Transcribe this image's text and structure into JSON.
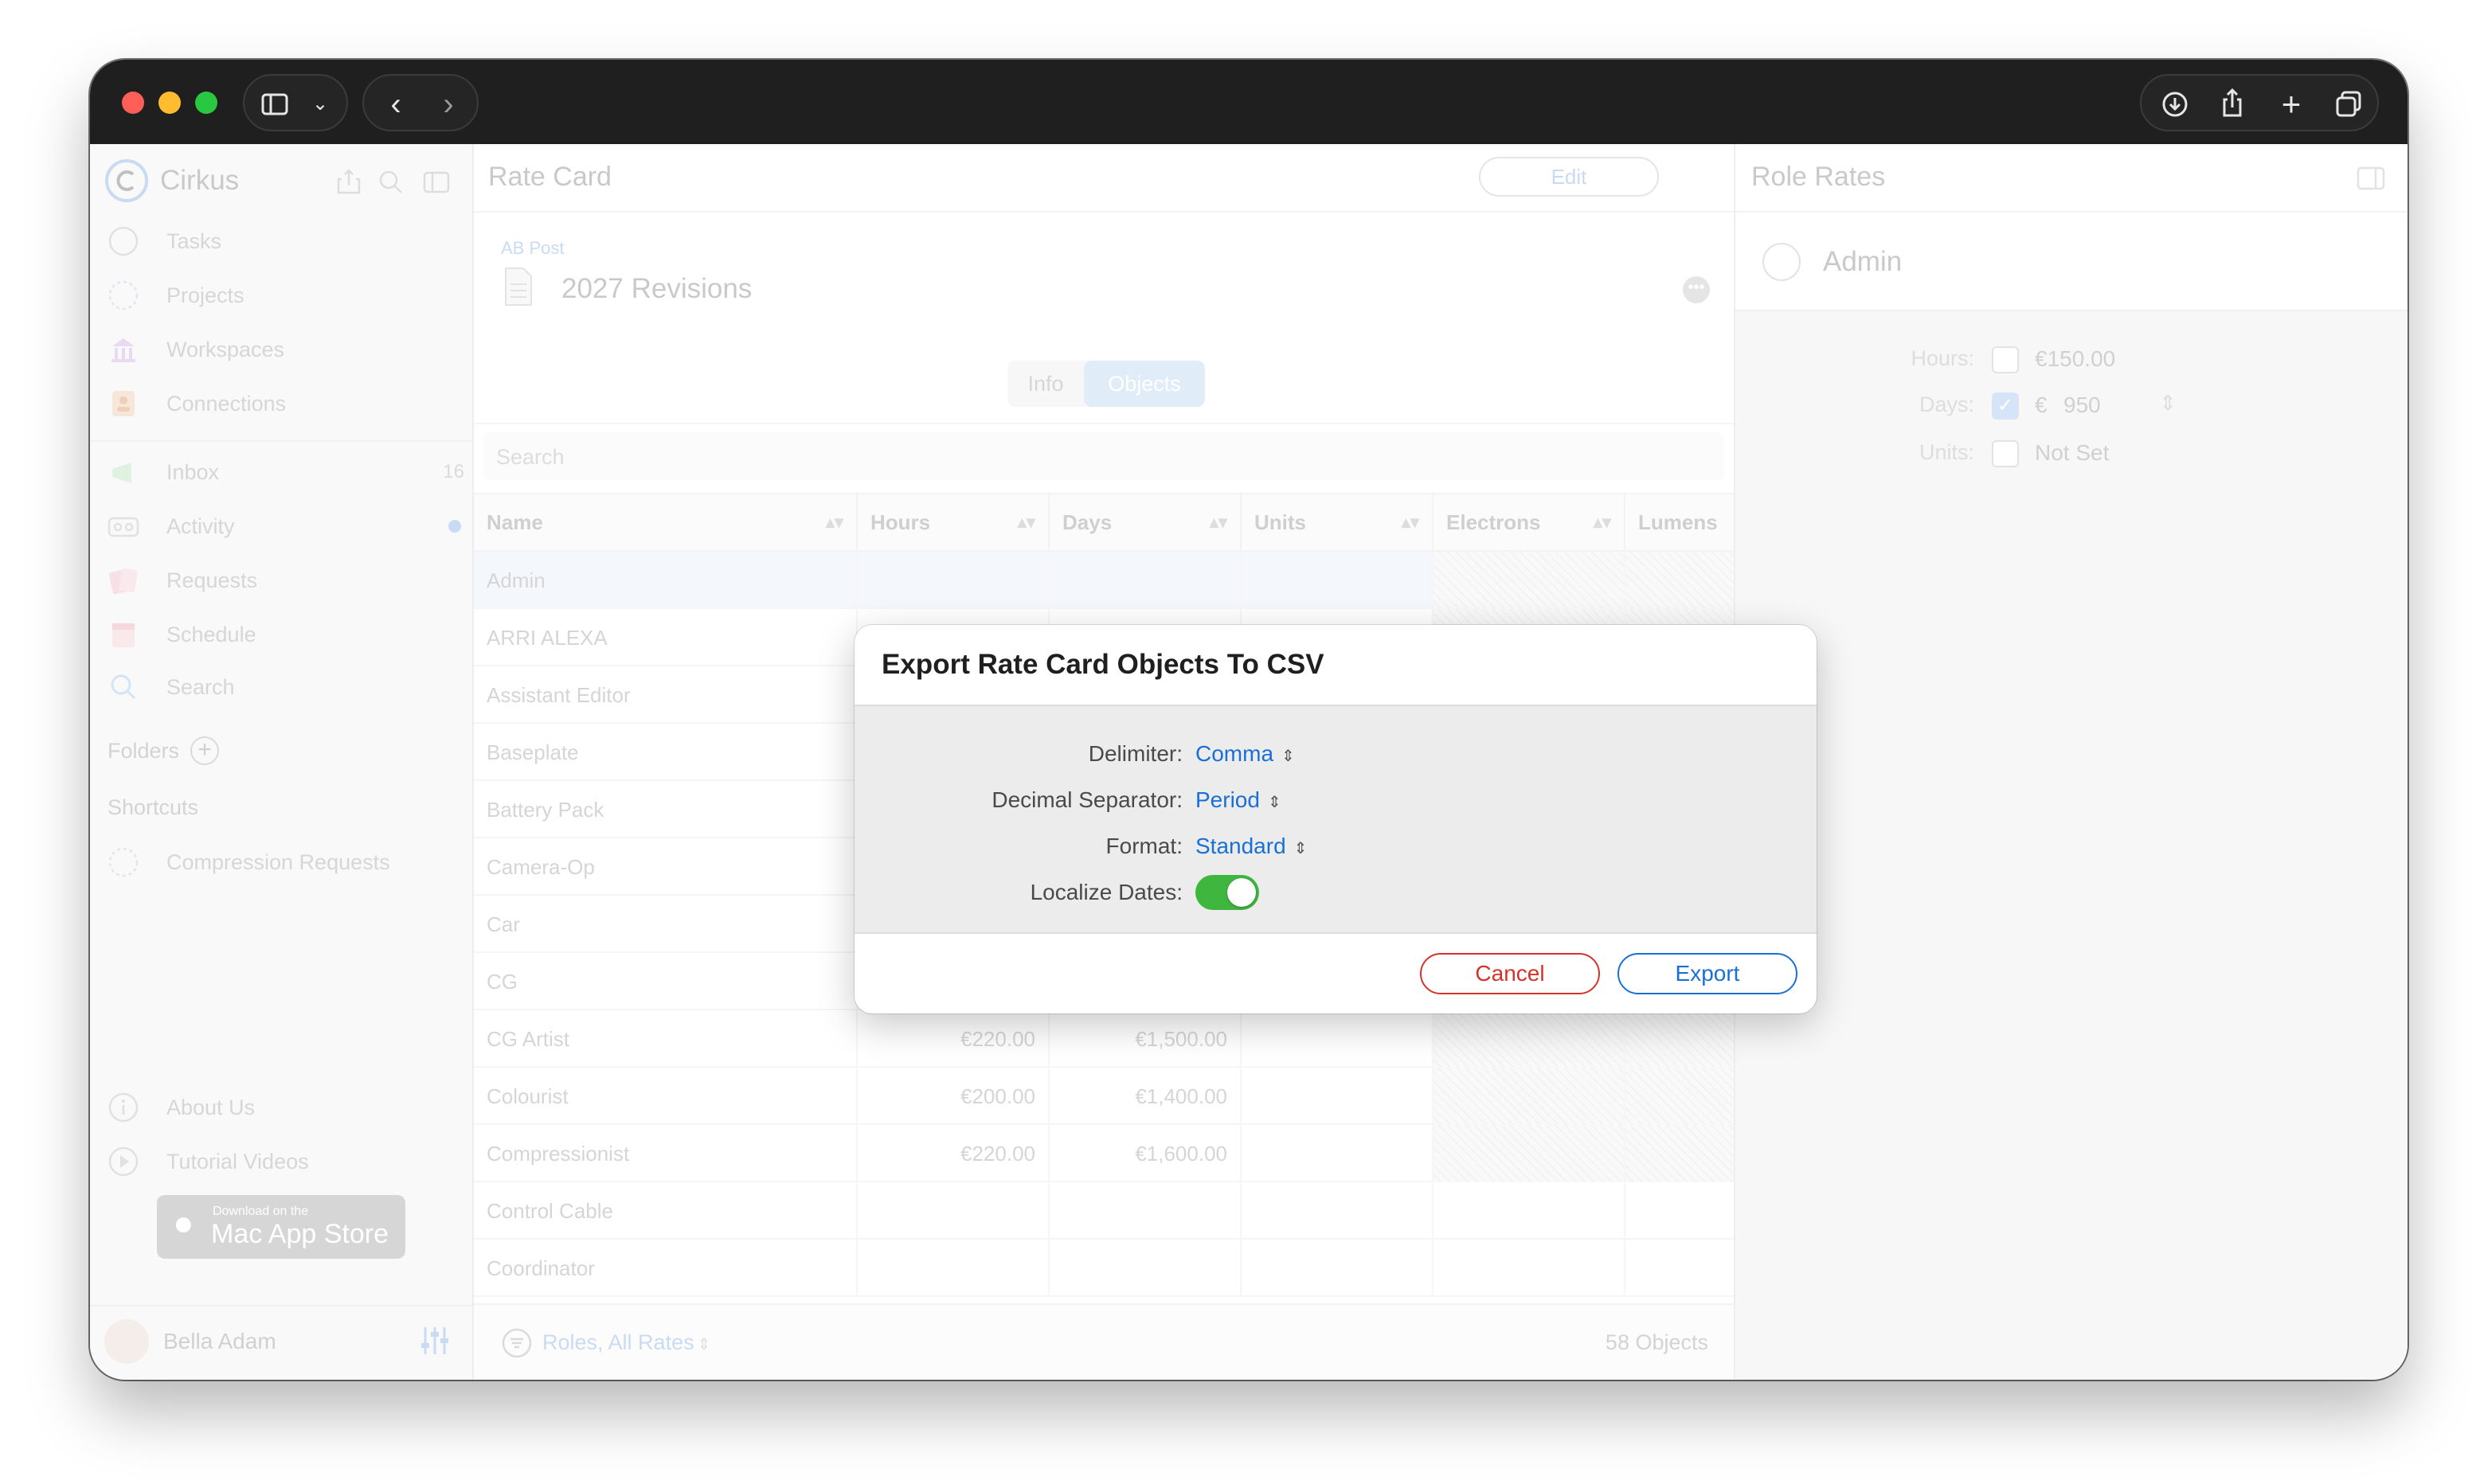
{
  "app": {
    "name": "Cirkus"
  },
  "sidebar": {
    "nav": [
      {
        "label": "Tasks",
        "icon": "circle-icon"
      },
      {
        "label": "Projects",
        "icon": "dashed-circle-icon"
      },
      {
        "label": "Workspaces",
        "icon": "carousel-icon"
      },
      {
        "label": "Connections",
        "icon": "contact-card-icon"
      }
    ],
    "nav2": [
      {
        "label": "Inbox",
        "icon": "megaphone-icon",
        "badge": "16"
      },
      {
        "label": "Activity",
        "icon": "voicemail-icon"
      },
      {
        "label": "Requests",
        "icon": "cards-icon"
      },
      {
        "label": "Schedule",
        "icon": "calendar-icon"
      },
      {
        "label": "Search",
        "icon": "search-icon"
      }
    ],
    "folders_label": "Folders",
    "shortcuts_label": "Shortcuts",
    "shortcuts": [
      {
        "label": "Compression Requests"
      }
    ],
    "bottom": [
      {
        "label": "About Us",
        "icon": "info-icon"
      },
      {
        "label": "Tutorial Videos",
        "icon": "play-icon"
      }
    ],
    "appstore": {
      "small": "Download on the",
      "big": "Mac App Store"
    },
    "user": {
      "name": "Bella Adam"
    }
  },
  "main": {
    "title": "Rate Card",
    "edit_label": "Edit",
    "breadcrumb": "AB Post",
    "doc_title": "2027 Revisions",
    "tabs": [
      {
        "label": "Info"
      },
      {
        "label": "Objects"
      }
    ],
    "search_placeholder": "Search",
    "columns": [
      "Name",
      "Hours",
      "Days",
      "Units",
      "Electrons",
      "Lumens"
    ],
    "rows": [
      {
        "name": "Admin",
        "hours": "",
        "days": ""
      },
      {
        "name": "ARRI ALEXA",
        "hours": "",
        "days": ""
      },
      {
        "name": "Assistant Editor",
        "hours": "",
        "days": ""
      },
      {
        "name": "Baseplate",
        "hours": "",
        "days": ""
      },
      {
        "name": "Battery Pack",
        "hours": "",
        "days": ""
      },
      {
        "name": "Camera-Op",
        "hours": "",
        "days": ""
      },
      {
        "name": "Car",
        "hours": "",
        "days": ""
      },
      {
        "name": "CG",
        "hours": "",
        "days": ""
      },
      {
        "name": "CG Artist",
        "hours": "€220.00",
        "days": "€1,500.00"
      },
      {
        "name": "Colourist",
        "hours": "€200.00",
        "days": "€1,400.00"
      },
      {
        "name": "Compressionist",
        "hours": "€220.00",
        "days": "€1,600.00"
      },
      {
        "name": "Control Cable",
        "hours": "",
        "days": ""
      },
      {
        "name": "Coordinator",
        "hours": "",
        "days": ""
      }
    ],
    "footer": {
      "filter": "Roles, All Rates",
      "count": "58 Objects"
    }
  },
  "right": {
    "title": "Role Rates",
    "role": "Admin",
    "fields": [
      {
        "label": "Hours:",
        "checked": false,
        "value": "€150.00"
      },
      {
        "label": "Days:",
        "checked": true,
        "currency": "€",
        "value": "950"
      },
      {
        "label": "Units:",
        "checked": false,
        "value": "Not Set"
      }
    ]
  },
  "dialog": {
    "title": "Export Rate Card Objects To CSV",
    "fields": [
      {
        "label": "Delimiter:",
        "value": "Comma"
      },
      {
        "label": "Decimal Separator:",
        "value": "Period"
      },
      {
        "label": "Format:",
        "value": "Standard"
      }
    ],
    "toggle": {
      "label": "Localize Dates:",
      "on": true
    },
    "cancel_label": "Cancel",
    "export_label": "Export"
  },
  "colors": {
    "accent": "#1a6fd6",
    "cancel": "#d6322c",
    "toggle": "#3fb73f",
    "titlebar": "#1f1f1f"
  }
}
